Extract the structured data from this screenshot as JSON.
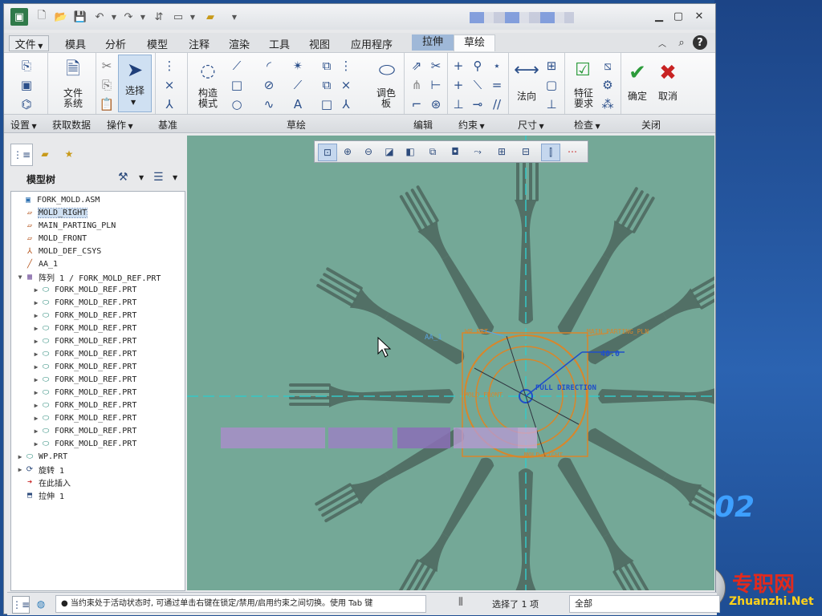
{
  "ribbon_tabs": [
    "文件",
    "模具",
    "分析",
    "模型",
    "注释",
    "渲染",
    "工具",
    "视图",
    "应用程序",
    "拉伸",
    "草绘"
  ],
  "active_tab": "草绘",
  "highlight_tab": "拉伸",
  "ribbon": {
    "file_system": "文件\n系统",
    "select": "选择",
    "construct_mode": "构造\n模式",
    "palette": "调色\n板",
    "normal": "法向",
    "feature_req": "特征\n要求",
    "ok": "确定",
    "cancel": "取消"
  },
  "group_labels": [
    "设置",
    "获取数据",
    "操作",
    "基准",
    "草绘",
    "编辑",
    "约束",
    "尺寸",
    "检查",
    "关闭"
  ],
  "model_tree": {
    "title": "模型树",
    "items": [
      {
        "label": "FORK_MOLD.ASM",
        "icon": "assembly-icon",
        "indent": 0,
        "expand": ""
      },
      {
        "label": "MOLD_RIGHT",
        "icon": "datum-plane-icon",
        "indent": 1,
        "expand": "",
        "selected": true
      },
      {
        "label": "MAIN_PARTING_PLN",
        "icon": "datum-plane-icon",
        "indent": 1,
        "expand": ""
      },
      {
        "label": "MOLD_FRONT",
        "icon": "datum-plane-icon",
        "indent": 1,
        "expand": ""
      },
      {
        "label": "MOLD_DEF_CSYS",
        "icon": "csys-icon",
        "indent": 1,
        "expand": ""
      },
      {
        "label": "AA_1",
        "icon": "axis-icon",
        "indent": 1,
        "expand": ""
      },
      {
        "label": "阵列 1 / FORK_MOLD_REF.PRT",
        "icon": "pattern-icon",
        "indent": 1,
        "expand": "▼"
      },
      {
        "label": "FORK_MOLD_REF.PRT",
        "icon": "part-icon",
        "indent": 2,
        "expand": "▶"
      },
      {
        "label": "FORK_MOLD_REF.PRT",
        "icon": "part-icon",
        "indent": 2,
        "expand": "▶"
      },
      {
        "label": "FORK_MOLD_REF.PRT",
        "icon": "part-icon",
        "indent": 2,
        "expand": "▶"
      },
      {
        "label": "FORK_MOLD_REF.PRT",
        "icon": "part-icon",
        "indent": 2,
        "expand": "▶"
      },
      {
        "label": "FORK_MOLD_REF.PRT",
        "icon": "part-icon",
        "indent": 2,
        "expand": "▶"
      },
      {
        "label": "FORK_MOLD_REF.PRT",
        "icon": "part-icon",
        "indent": 2,
        "expand": "▶"
      },
      {
        "label": "FORK_MOLD_REF.PRT",
        "icon": "part-icon",
        "indent": 2,
        "expand": "▶"
      },
      {
        "label": "FORK_MOLD_REF.PRT",
        "icon": "part-icon",
        "indent": 2,
        "expand": "▶"
      },
      {
        "label": "FORK_MOLD_REF.PRT",
        "icon": "part-icon",
        "indent": 2,
        "expand": "▶"
      },
      {
        "label": "FORK_MOLD_REF.PRT",
        "icon": "part-icon",
        "indent": 2,
        "expand": "▶"
      },
      {
        "label": "FORK_MOLD_REF.PRT",
        "icon": "part-icon",
        "indent": 2,
        "expand": "▶"
      },
      {
        "label": "FORK_MOLD_REF.PRT",
        "icon": "part-icon",
        "indent": 2,
        "expand": "▶"
      },
      {
        "label": "FORK_MOLD_REF.PRT",
        "icon": "part-icon",
        "indent": 2,
        "expand": "▶"
      },
      {
        "label": "WP.PRT",
        "icon": "part-icon",
        "indent": 1,
        "expand": "▶"
      },
      {
        "label": "旋转 1",
        "icon": "revolve-icon",
        "indent": 1,
        "expand": "▶"
      },
      {
        "label": "在此插入",
        "icon": "insert-arrow-icon",
        "indent": 1,
        "expand": ""
      },
      {
        "label": "拉伸 1",
        "icon": "extrude-icon",
        "indent": 1,
        "expand": ""
      }
    ]
  },
  "sketch": {
    "dim_value": "40.0",
    "pull_direction": "PULL DIRECTION",
    "main_parting": "MAIN_PARTING_PLN",
    "mold_front": "MOLD_FRONT",
    "aa_label": "AA_1",
    "wp_label": "WP.PRT",
    "bottom_label": "MOLD_RIGHT"
  },
  "status": {
    "message": "● 当约束处于活动状态时, 可通过单击右键在锁定/禁用/启用约束之间切换。使用 Tab 键",
    "selection": "选择了 1 项",
    "filter": "全部"
  },
  "brand": {
    "version": "02",
    "site_cn": "专职网",
    "site_url": "Zhuanzhi.Net"
  },
  "colors": {
    "viewport_bg": "#74a897",
    "fork": "#4f6b62",
    "sketch_orange": "#d9862a",
    "sketch_blue": "#1f4fc9",
    "axis_cyan": "#35c7c7"
  }
}
